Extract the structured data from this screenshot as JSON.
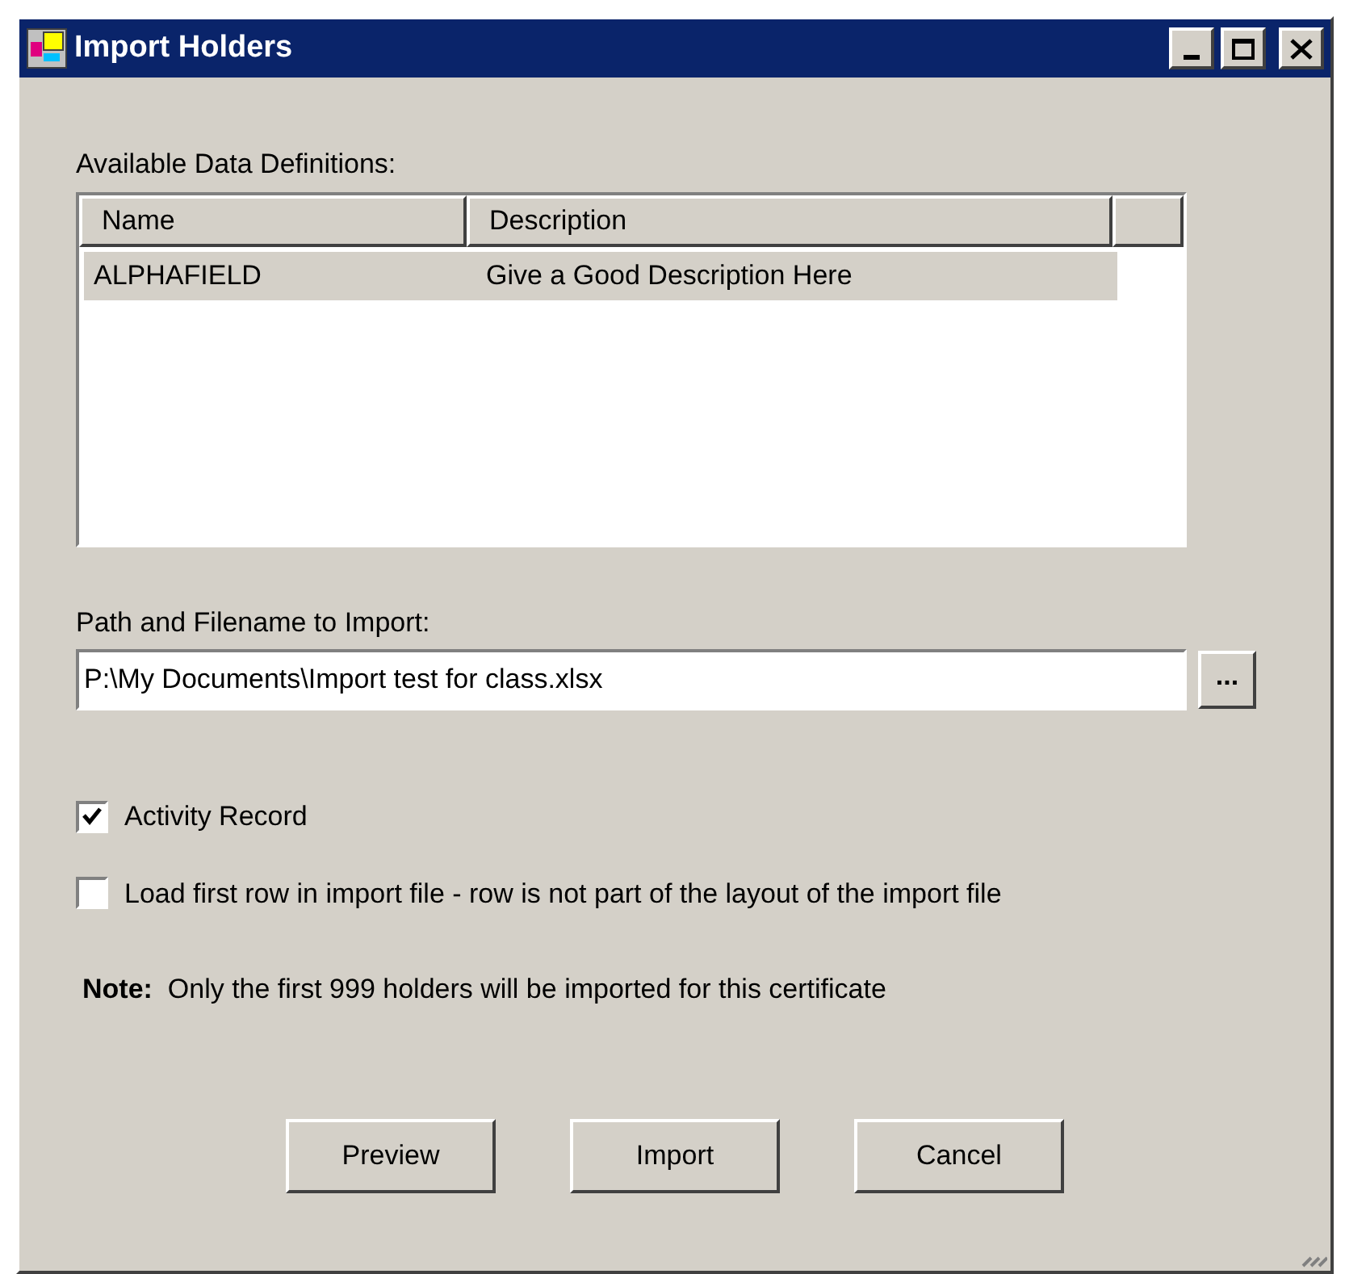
{
  "window": {
    "title": "Import Holders"
  },
  "definitions": {
    "label": "Available Data Definitions:",
    "columns": [
      "Name",
      "Description"
    ],
    "rows": [
      {
        "name": "ALPHAFIELD",
        "description": "Give a Good Description Here",
        "selected": true
      }
    ]
  },
  "path": {
    "label": "Path and Filename to Import:",
    "value": "P:\\My Documents\\Import test for class.xlsx",
    "browse": "..."
  },
  "options": [
    {
      "label": "Activity Record",
      "checked": true
    },
    {
      "label": "Load first row in import file - row is not part of the layout of the import file",
      "checked": false
    }
  ],
  "note": "**Note:**  Only the first 999 holders will be imported for this certificate",
  "buttons": [
    "Preview",
    "Import",
    "Cancel"
  ]
}
